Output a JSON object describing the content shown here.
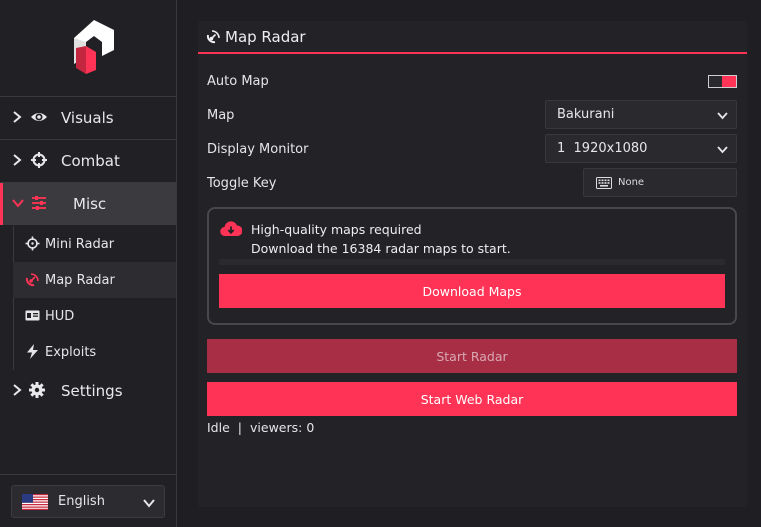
{
  "sidebar": {
    "items": [
      {
        "label": "Visuals",
        "icon": "eye-icon"
      },
      {
        "label": "Combat",
        "icon": "crosshair-icon"
      },
      {
        "label": "Misc",
        "icon": "sliders-icon"
      }
    ],
    "sub_items": [
      {
        "label": "Mini Radar",
        "icon": "crosshair-small-icon"
      },
      {
        "label": "Map Radar",
        "icon": "radar-icon"
      },
      {
        "label": "HUD",
        "icon": "id-card-icon"
      },
      {
        "label": "Exploits",
        "icon": "lightning-icon"
      }
    ],
    "settings": {
      "label": "Settings",
      "icon": "gear-icon"
    },
    "language": {
      "label": "English",
      "icon": "us-flag-icon"
    }
  },
  "panel": {
    "title": "Map Radar",
    "auto_map": {
      "label": "Auto Map",
      "enabled": true
    },
    "map": {
      "label": "Map",
      "value": "Bakurani"
    },
    "display_monitor": {
      "label": "Display Monitor",
      "value": "1  1920x1080"
    },
    "toggle_key": {
      "label": "Toggle Key",
      "value": "None"
    },
    "notice": {
      "title": "High-quality maps required",
      "message": "Download the 16384 radar maps to start.",
      "button": "Download Maps"
    },
    "start_radar": "Start Radar",
    "start_web_radar": "Start Web Radar",
    "status": {
      "state": "Idle",
      "separator": "|",
      "viewers": "viewers: 0"
    }
  },
  "colors": {
    "accent": "#ff3355",
    "accent_dim": "#a82e45",
    "background": "#1f1f23",
    "panel": "#232327"
  }
}
